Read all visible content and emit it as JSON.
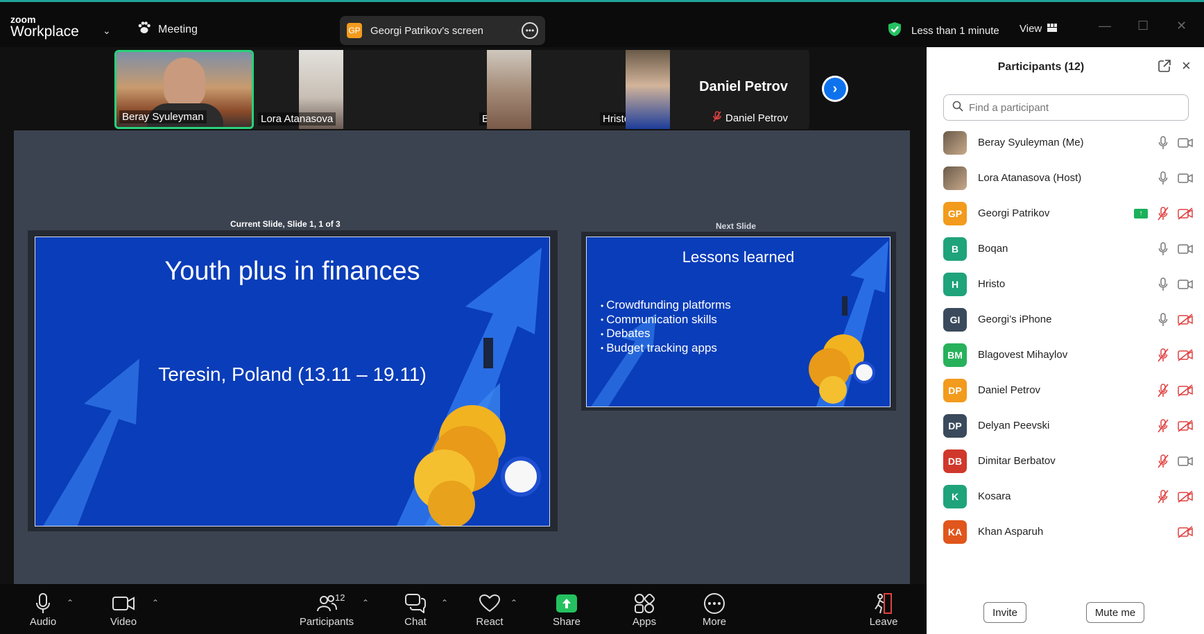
{
  "brand": {
    "small": "zoom",
    "big": "Workplace"
  },
  "meeting_label": "Meeting",
  "screen_share": {
    "chip": "GP",
    "label": "Georgi Patrikov's screen"
  },
  "security": {
    "text": "Less than 1 minute",
    "color": "#24c160"
  },
  "view_label": "View",
  "thumbnails": [
    {
      "name": "Beray Syuleyman"
    },
    {
      "name": "Lora Atanasova"
    },
    {
      "name": "Boqan"
    },
    {
      "name": "Hristo"
    },
    {
      "name": "Daniel Petrov",
      "big_name": "Daniel Petrov"
    }
  ],
  "current_slide": {
    "caption": "Current Slide, Slide 1, 1 of 3",
    "title": "Youth plus in finances",
    "subtitle": "Teresin, Poland (13.11 – 19.11)"
  },
  "next_slide": {
    "caption": "Next Slide",
    "title": "Lessons learned",
    "bullets": [
      "Crowdfunding platforms",
      "Communication skills",
      "Debates",
      "Budget tracking apps"
    ]
  },
  "toolbar": {
    "audio": "Audio",
    "video": "Video",
    "participants": "Participants",
    "participants_count": "12",
    "chat": "Chat",
    "react": "React",
    "share": "Share",
    "apps": "Apps",
    "more": "More",
    "leave": "Leave"
  },
  "panel": {
    "title": "Participants (12)",
    "search_placeholder": "Find a participant",
    "invite": "Invite",
    "mute_me": "Mute me",
    "participants": [
      {
        "name": "Beray Syuleyman (Me)",
        "avatar": "",
        "color": "",
        "mic": "on",
        "cam": "on"
      },
      {
        "name": "Lora Atanasova (Host)",
        "avatar": "",
        "color": "",
        "mic": "on",
        "cam": "on"
      },
      {
        "name": "Georgi Patrikov",
        "avatar": "GP",
        "color": "#f29b1d",
        "mic": "off",
        "cam": "off",
        "sharing": true
      },
      {
        "name": "Boqan",
        "avatar": "B",
        "color": "#1fa37a",
        "mic": "on",
        "cam": "on"
      },
      {
        "name": "Hristo",
        "avatar": "H",
        "color": "#1fa37a",
        "mic": "on",
        "cam": "on"
      },
      {
        "name": "Georgi’s iPhone",
        "avatar": "GI",
        "color": "#3a4a5c",
        "mic": "on",
        "cam": "off"
      },
      {
        "name": "Blagovest Mihaylov",
        "avatar": "BM",
        "color": "#27b15b",
        "mic": "off",
        "cam": "off"
      },
      {
        "name": "Daniel Petrov",
        "avatar": "DP",
        "color": "#f29b1d",
        "mic": "off",
        "cam": "off"
      },
      {
        "name": "Delyan Peevski",
        "avatar": "DP",
        "color": "#3a4a5c",
        "mic": "off",
        "cam": "off"
      },
      {
        "name": "Dimitar Berbatov",
        "avatar": "DB",
        "color": "#d0382b",
        "mic": "off",
        "cam": "on"
      },
      {
        "name": "Kosara",
        "avatar": "K",
        "color": "#1fa37a",
        "mic": "off",
        "cam": "off"
      },
      {
        "name": "Khan Asparuh",
        "avatar": "KA",
        "color": "#e0561c",
        "mic": "none",
        "cam": "off"
      }
    ]
  }
}
